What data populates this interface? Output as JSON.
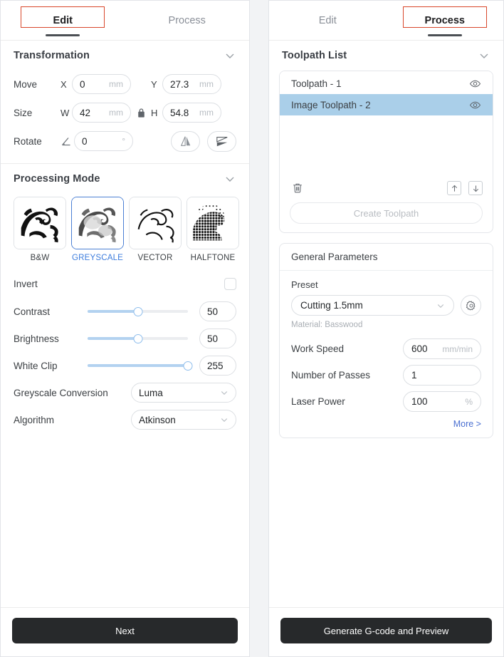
{
  "left_panel": {
    "tabs": [
      {
        "label": "Edit",
        "active": true
      },
      {
        "label": "Process",
        "active": false
      }
    ],
    "transformation": {
      "title": "Transformation",
      "collapse_icon": "chevron-down-icon",
      "move_label": "Move",
      "move_x_axis": "X",
      "move_x_value": "0",
      "move_x_unit": "mm",
      "move_y_axis": "Y",
      "move_y_value": "27.3",
      "move_y_unit": "mm",
      "size_label": "Size",
      "size_w_axis": "W",
      "size_w_value": "42",
      "size_w_unit": "mm",
      "lock_icon": "lock-icon",
      "size_h_axis": "H",
      "size_h_value": "54.8",
      "size_h_unit": "mm",
      "rotate_label": "Rotate",
      "rotate_icon": "angle-icon",
      "rotate_value": "0",
      "rotate_unit": "°",
      "mirror_vertical_icon": "mirror-vertical-icon",
      "mirror_horizontal_icon": "mirror-horizontal-icon"
    },
    "processing_mode": {
      "title": "Processing Mode",
      "collapse_icon": "chevron-down-icon",
      "modes": [
        {
          "label": "B&W",
          "selected": false
        },
        {
          "label": "GREYSCALE",
          "selected": true
        },
        {
          "label": "VECTOR",
          "selected": false
        },
        {
          "label": "HALFTONE",
          "selected": false
        }
      ],
      "invert_label": "Invert",
      "invert_checked": false,
      "sliders": [
        {
          "label": "Contrast",
          "value": "50",
          "percent": 50
        },
        {
          "label": "Brightness",
          "value": "50",
          "percent": 50
        },
        {
          "label": "White Clip",
          "value": "255",
          "percent": 100
        }
      ],
      "greyscale_conversion_label": "Greyscale Conversion",
      "greyscale_conversion_value": "Luma",
      "algorithm_label": "Algorithm",
      "algorithm_value": "Atkinson"
    },
    "bottom_button": "Next"
  },
  "right_panel": {
    "tabs": [
      {
        "label": "Edit",
        "active": false
      },
      {
        "label": "Process",
        "active": true
      }
    ],
    "toolpath_list": {
      "title": "Toolpath List",
      "collapse_icon": "chevron-down-icon",
      "items": [
        {
          "label": "Toolpath - 1",
          "selected": false,
          "visibility_icon": "eye-icon"
        },
        {
          "label": "Image Toolpath - 2",
          "selected": true,
          "visibility_icon": "eye-icon"
        }
      ],
      "delete_icon": "trash-icon",
      "move_up_icon": "arrow-up-icon",
      "move_down_icon": "arrow-down-icon",
      "create_button": "Create Toolpath"
    },
    "general_parameters": {
      "title": "General Parameters",
      "preset_label": "Preset",
      "preset_value": "Cutting 1.5mm",
      "settings_icon": "gear-icon",
      "material_note": "Material: Basswood",
      "rows": [
        {
          "label": "Work Speed",
          "value": "600",
          "unit": "mm/min"
        },
        {
          "label": "Number of Passes",
          "value": "1",
          "unit": ""
        },
        {
          "label": "Laser Power",
          "value": "100",
          "unit": "%"
        }
      ],
      "more_link": "More >"
    },
    "bottom_button": "Generate G-code and Preview"
  },
  "colors": {
    "tab_focus_outline": "#d9472b",
    "tab_active_underline": "#4b4f54",
    "selection_blue": "#aacfe9",
    "accent_blue": "#3d7ddd",
    "link_blue": "#4a6fd1",
    "primary_button_bg": "#27292b"
  }
}
